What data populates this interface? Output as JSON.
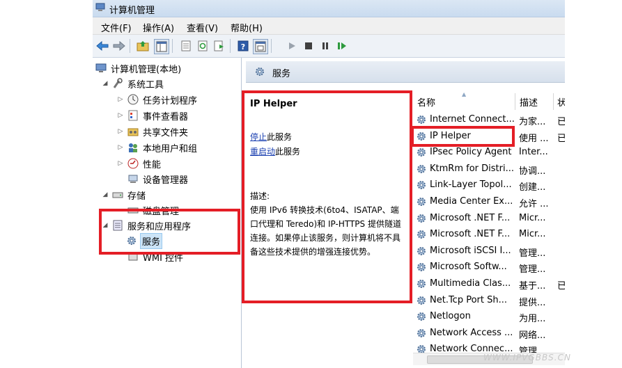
{
  "window": {
    "title": "计算机管理"
  },
  "menu": [
    "文件(F)",
    "操作(A)",
    "查看(V)",
    "帮助(H)"
  ],
  "toolbar_icons": [
    "back-icon",
    "forward-icon",
    "up-folder-icon",
    "show-tree-icon",
    "properties-icon",
    "refresh-icon",
    "export-icon",
    "help-icon",
    "view-icon",
    "play-icon",
    "stop-icon",
    "pause-icon",
    "resume-icon"
  ],
  "tree": {
    "root": "计算机管理(本地)",
    "system_tools": "系统工具",
    "task_scheduler": "任务计划程序",
    "event_viewer": "事件查看器",
    "shared_folders": "共享文件夹",
    "local_users": "本地用户和组",
    "performance": "性能",
    "device_manager": "设备管理器",
    "storage": "存储",
    "disk_mgmt": "磁盘管理",
    "services_apps": "服务和应用程序",
    "services": "服务",
    "wmi": "WMI 控件"
  },
  "content": {
    "header": "服务",
    "detail": {
      "name": "IP Helper",
      "stop_link": "停止",
      "stop_suffix": "此服务",
      "restart_link": "重启动",
      "restart_suffix": "此服务",
      "desc_label": "描述:",
      "desc_text": "使用 IPv6 转换技术(6to4、ISATAP、端口代理和 Teredo)和 IP-HTTPS 提供隧道连接。如果停止该服务，则计算机将不具备这些技术提供的增强连接优势。"
    },
    "columns": {
      "name": "名称",
      "desc": "描述",
      "status": "状"
    },
    "services": [
      {
        "name": "Internet Connect...",
        "desc": "为家...",
        "status": "已"
      },
      {
        "name": "IP Helper",
        "desc": "使用 ...",
        "status": "已"
      },
      {
        "name": "IPsec Policy Agent",
        "desc": "Inter...",
        "status": ""
      },
      {
        "name": "KtmRm for Distri...",
        "desc": "协调...",
        "status": ""
      },
      {
        "name": "Link-Layer Topol...",
        "desc": "创建...",
        "status": ""
      },
      {
        "name": "Media Center Ex...",
        "desc": "允许 ...",
        "status": ""
      },
      {
        "name": "Microsoft .NET F...",
        "desc": "Micr...",
        "status": ""
      },
      {
        "name": "Microsoft .NET F...",
        "desc": "Micr...",
        "status": ""
      },
      {
        "name": "Microsoft iSCSI I...",
        "desc": "管理...",
        "status": ""
      },
      {
        "name": "Microsoft Softw...",
        "desc": "管理...",
        "status": ""
      },
      {
        "name": "Multimedia Clas...",
        "desc": "基于...",
        "status": "已"
      },
      {
        "name": "Net.Tcp Port Sh...",
        "desc": "提供...",
        "status": ""
      },
      {
        "name": "Netlogon",
        "desc": "为用...",
        "status": ""
      },
      {
        "name": "Network Access ...",
        "desc": "网络...",
        "status": ""
      },
      {
        "name": "Network Connec...",
        "desc": "管理...",
        "status": ""
      }
    ]
  },
  "watermark": "WWW.IPVGBBS.CN",
  "colors": {
    "highlight_red": "#e41e26",
    "link_blue": "#1a3fb0",
    "selection": "#cce4f7"
  }
}
